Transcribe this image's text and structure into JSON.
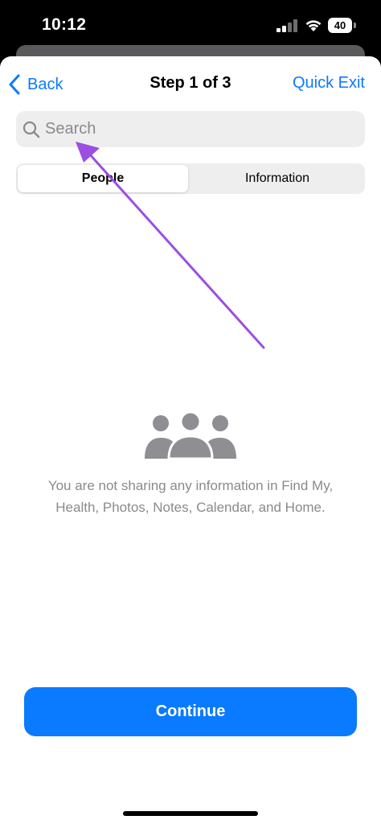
{
  "status_bar": {
    "time": "10:12",
    "battery": "40"
  },
  "nav": {
    "back_label": "Back",
    "title": "Step 1 of 3",
    "quick_exit_label": "Quick Exit"
  },
  "search": {
    "placeholder": "Search",
    "value": ""
  },
  "segmented_control": {
    "options": [
      "People",
      "Information"
    ],
    "selected": "People"
  },
  "empty_state": {
    "icon": "people-group-icon",
    "message": "You are not sharing any information in Find My, Health, Photos, Notes, Calendar, and Home."
  },
  "continue_label": "Continue",
  "colors": {
    "accent": "#0a7aff",
    "annotation_arrow": "#9b4fe0",
    "muted_text": "#8a8a8e",
    "control_bg": "#eeeeef"
  }
}
